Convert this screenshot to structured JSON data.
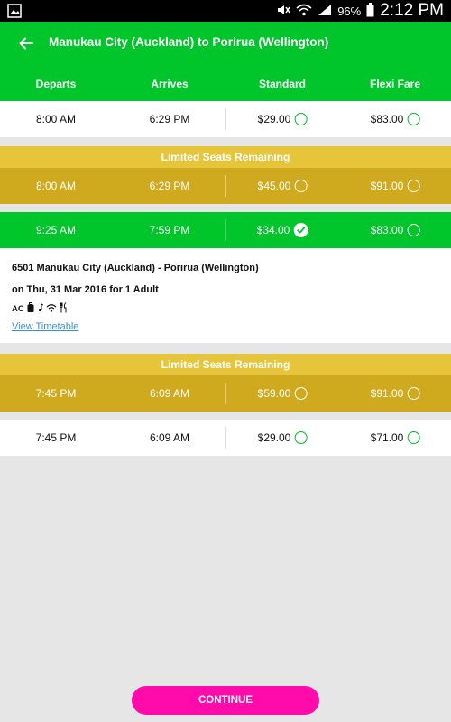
{
  "status_bar": {
    "battery": "96%",
    "time": "2:12 PM",
    "icons": [
      "gallery-icon",
      "mute-icon",
      "wifi-icon",
      "signal-icon",
      "battery-icon"
    ]
  },
  "header": {
    "title": "Manukau City (Auckland) to Porirua (Wellington)"
  },
  "columns": {
    "departs": "Departs",
    "arrives": "Arrives",
    "standard": "Standard",
    "flexi": "Flexi Fare"
  },
  "banner_label": "Limited Seats Remaining",
  "rows": [
    {
      "departs": "8:00 AM",
      "arrives": "6:29 PM",
      "standard": "$29.00",
      "flexi": "$83.00",
      "style": "normal"
    },
    {
      "departs": "8:00 AM",
      "arrives": "6:29 PM",
      "standard": "$45.00",
      "flexi": "$91.00",
      "style": "limited"
    },
    {
      "departs": "9:25 AM",
      "arrives": "7:59 PM",
      "standard": "$34.00",
      "flexi": "$83.00",
      "style": "selected",
      "selected_fare": "standard"
    },
    {
      "departs": "7:45 PM",
      "arrives": "6:09 AM",
      "standard": "$59.00",
      "flexi": "$91.00",
      "style": "limited"
    },
    {
      "departs": "7:45 PM",
      "arrives": "6:09 AM",
      "standard": "$29.00",
      "flexi": "$71.00",
      "style": "normal"
    }
  ],
  "details": {
    "service": "6501 Manukau City (Auckland) - Porirua (Wellington)",
    "date_line": "on Thu, 31 Mar 2016 for 1 Adult",
    "amenities_text": "AC",
    "amenity_icons": [
      "luggage-icon",
      "music-icon",
      "wifi-icon",
      "food-icon"
    ],
    "view_timetable": "View Timetable"
  },
  "continue_label": "CONTINUE",
  "colors": {
    "brand_green": "#00c52b",
    "limited_gold": "#d0aa1e",
    "limited_banner": "#e7c53a",
    "accent_pink": "#ff0aab",
    "link_blue": "#3a8fd9"
  }
}
